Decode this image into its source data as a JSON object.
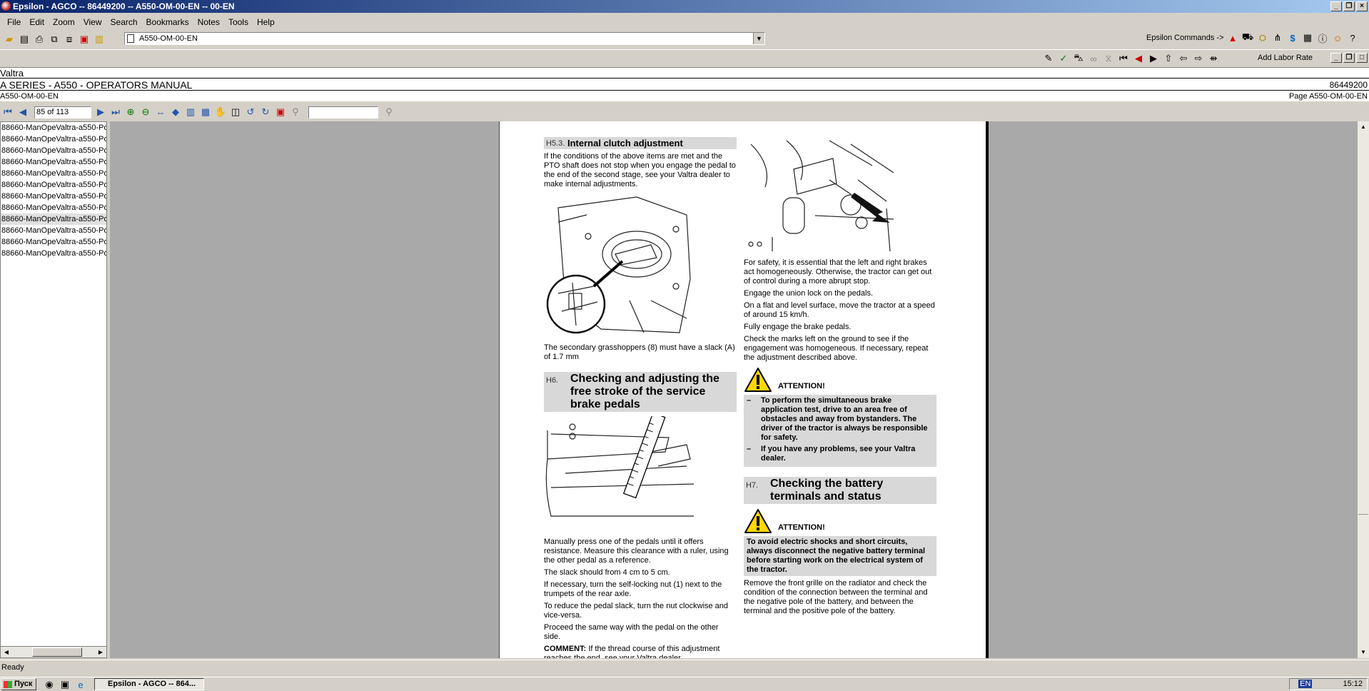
{
  "window": {
    "title": "Epsilon - AGCO -- 86449200 -- A550-OM-00-EN -- 00-EN"
  },
  "menu": [
    "File",
    "Edit",
    "Zoom",
    "View",
    "Search",
    "Bookmarks",
    "Notes",
    "Tools",
    "Help"
  ],
  "address": {
    "value": "A550-OM-00-EN"
  },
  "commands": {
    "label": "Epsilon Commands ->",
    "labor_label": "Add Labor Rate"
  },
  "header": {
    "brand": "Valtra",
    "title": "A SERIES - A550  - OPERATORS MANUAL",
    "part_number": "86449200",
    "doc_id": "A550-OM-00-EN",
    "page_ref": "Page A550-OM-00-EN"
  },
  "nav": {
    "page_indicator": "85 of 113"
  },
  "sidebar": {
    "items": [
      "88660-ManOpeValtra-a550-Po",
      "88660-ManOpeValtra-a550-Po",
      "88660-ManOpeValtra-a550-Po",
      "88660-ManOpeValtra-a550-Po",
      "88660-ManOpeValtra-a550-Po",
      "88660-ManOpeValtra-a550-Po",
      "88660-ManOpeValtra-a550-Po",
      "88660-ManOpeValtra-a550-Po",
      "88660-ManOpeValtra-a550-Po",
      "88660-ManOpeValtra-a550-Po",
      "88660-ManOpeValtra-a550-Po",
      "88660-ManOpeValtra-a550-Po"
    ],
    "selected_index": 8
  },
  "doc": {
    "left": {
      "s1_num": "H5.3.",
      "s1_title": "Internal clutch adjustment",
      "s1_p1": "If the conditions of the above items are met and the PTO shaft does not stop when you engage the pedal to the end of the second stage, see your Valtra dealer to make internal adjustments.",
      "s1_caption": "The secondary grasshoppers (8) must have a slack (A) of 1.7 mm",
      "s2_num": "H6.",
      "s2_title": "Checking and adjusting the free stroke of the service brake pedals",
      "s2_p1": "Manually press one of the pedals until it offers resistance. Measure this clearance with a ruler, using the other pedal as a reference.",
      "s2_p2": "The slack should from 4 cm to 5 cm.",
      "s2_p3": "If necessary, turn the self-locking nut (1) next to the trumpets of the rear axle.",
      "s2_p4": "To reduce the pedal slack, turn the nut clockwise and vice-versa.",
      "s2_p5": "Proceed the same way with the pedal on the other side.",
      "comment_label": "COMMENT:",
      "comment_text": " If the thread course of this adjustment reaches the end, see your Valtra dealer."
    },
    "right": {
      "p1": "For safety, it is essential that the left and right brakes act homogeneously. Otherwise, the tractor can get out of control during a more abrupt stop.",
      "p2": "Engage the union lock on the pedals.",
      "p3": "On a flat and level surface, move the tractor at a speed of around 15 km/h.",
      "p4": "Fully engage the brake pedals.",
      "p5": "Check the marks left on the ground to see if the engagement was homogeneous. If necessary, repeat the adjustment described above.",
      "attention1": "ATTENTION!",
      "warn1_a": "To perform the simultaneous brake application test, drive to an area free of obstacles and away from bystanders. The driver of the tractor is always be responsible for safety.",
      "warn1_b": "If you have any problems, see your Valtra dealer.",
      "s3_num": "H7.",
      "s3_title": "Checking the battery terminals and status",
      "attention2": "ATTENTION!",
      "warn2": "To avoid electric shocks and short circuits, always disconnect the negative battery terminal before starting work on the electrical system of the tractor.",
      "p6": "Remove the front grille on the radiator and check the condition of the connection between the terminal and the negative pole of the battery, and between the terminal and the positive pole of the battery."
    }
  },
  "status": {
    "text": "Ready"
  },
  "taskbar": {
    "start": "Пуск",
    "task": "Epsilon - AGCO -- 864...",
    "lang": "EN",
    "time": "15:12"
  }
}
